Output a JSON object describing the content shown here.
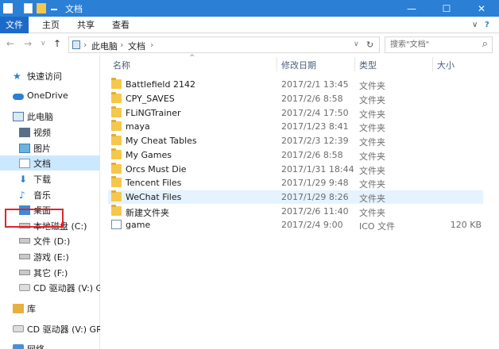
{
  "window": {
    "title": "文档",
    "controls": {
      "minimize": "—",
      "maximize": "☐",
      "close": "✕"
    }
  },
  "ribbon": {
    "tabs": [
      "文件",
      "主页",
      "共享",
      "查看"
    ],
    "collapse_glyph": "∨",
    "help_glyph": "?"
  },
  "address": {
    "back": "←",
    "forward": "→",
    "recent": "∨",
    "up": "↑",
    "path": [
      "此电脑",
      "文档"
    ],
    "separator": "›",
    "dropdown": "∨",
    "refresh": "↻"
  },
  "search": {
    "placeholder": "搜索\"文档\"",
    "icon": "⌕"
  },
  "nav": {
    "items": [
      {
        "label": "快速访问",
        "icon": "star-icon"
      },
      {
        "label": "OneDrive",
        "icon": "cloud-icon"
      },
      {
        "label": "此电脑",
        "icon": "computer-icon"
      },
      {
        "label": "视频",
        "icon": "video-icon"
      },
      {
        "label": "图片",
        "icon": "pictures-icon"
      },
      {
        "label": "文档",
        "icon": "documents-icon"
      },
      {
        "label": "下载",
        "icon": "download-icon"
      },
      {
        "label": "音乐",
        "icon": "music-icon"
      },
      {
        "label": "桌面",
        "icon": "desktop-icon"
      },
      {
        "label": "本地磁盘 (C:)",
        "icon": "drive-icon"
      },
      {
        "label": "文件 (D:)",
        "icon": "drive-icon"
      },
      {
        "label": "游戏 (E:)",
        "icon": "drive-icon"
      },
      {
        "label": "其它 (F:)",
        "icon": "drive-icon"
      },
      {
        "label": "CD 驱动器 (V:) GRTM",
        "icon": "cd-drive-icon"
      },
      {
        "label": "库",
        "icon": "library-icon"
      },
      {
        "label": "CD 驱动器 (V:) GRTM",
        "icon": "cd-drive-icon"
      },
      {
        "label": "网络",
        "icon": "network-icon"
      }
    ]
  },
  "list": {
    "columns": {
      "name": "名称",
      "date": "修改日期",
      "type": "类型",
      "size": "大小"
    },
    "sort_glyph": "^",
    "rows": [
      {
        "name": "Battlefield 2142",
        "date": "2017/2/1 13:45",
        "type": "文件夹",
        "size": ""
      },
      {
        "name": "CPY_SAVES",
        "date": "2017/2/6 8:58",
        "type": "文件夹",
        "size": ""
      },
      {
        "name": "FLiNGTrainer",
        "date": "2017/2/4 17:50",
        "type": "文件夹",
        "size": ""
      },
      {
        "name": "maya",
        "date": "2017/1/23 8:41",
        "type": "文件夹",
        "size": ""
      },
      {
        "name": "My Cheat Tables",
        "date": "2017/2/3 12:39",
        "type": "文件夹",
        "size": ""
      },
      {
        "name": "My Games",
        "date": "2017/2/6 8:58",
        "type": "文件夹",
        "size": ""
      },
      {
        "name": "Orcs Must Die",
        "date": "2017/1/31 18:44",
        "type": "文件夹",
        "size": ""
      },
      {
        "name": "Tencent Files",
        "date": "2017/1/29 9:48",
        "type": "文件夹",
        "size": ""
      },
      {
        "name": "WeChat Files",
        "date": "2017/1/29 8:26",
        "type": "文件夹",
        "size": ""
      },
      {
        "name": "新建文件夹",
        "date": "2017/2/6 11:40",
        "type": "文件夹",
        "size": ""
      },
      {
        "name": "game",
        "date": "2017/2/4 9:00",
        "type": "ICO 文件",
        "size": "120 KB"
      }
    ]
  },
  "colors": {
    "titlebar": "#2b7fd4",
    "active_tab": "#1b6ac9",
    "selection": "#cce8ff",
    "hover_row": "#e5f3ff",
    "highlight_box": "#e0252b",
    "folder": "#f5c84c"
  }
}
